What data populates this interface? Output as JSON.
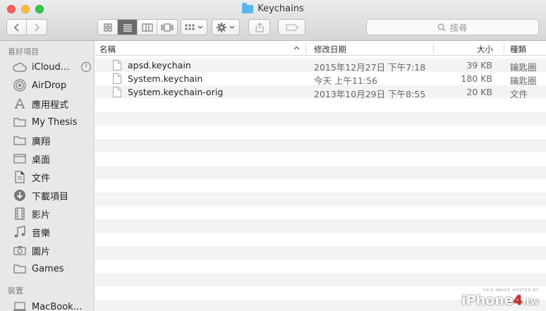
{
  "window": {
    "title": "Keychains"
  },
  "toolbar": {
    "search_placeholder": "搜尋"
  },
  "sidebar": {
    "favorites_heading": "喜好項目",
    "favorites": [
      {
        "label": "iCloud…",
        "icon": "cloud-icon"
      },
      {
        "label": "AirDrop",
        "icon": "airdrop-icon"
      },
      {
        "label": "應用程式",
        "icon": "applications-icon"
      },
      {
        "label": "My Thesis",
        "icon": "folder-icon"
      },
      {
        "label": "廣翔",
        "icon": "folder-icon"
      },
      {
        "label": "桌面",
        "icon": "desktop-icon"
      },
      {
        "label": "文件",
        "icon": "documents-icon"
      },
      {
        "label": "下載項目",
        "icon": "downloads-icon"
      },
      {
        "label": "影片",
        "icon": "movies-icon"
      },
      {
        "label": "音樂",
        "icon": "music-icon"
      },
      {
        "label": "圖片",
        "icon": "pictures-icon"
      },
      {
        "label": "Games",
        "icon": "folder-icon"
      }
    ],
    "devices_heading": "裝置",
    "devices": [
      {
        "label": "MacBook…",
        "icon": "laptop-icon"
      }
    ]
  },
  "columns": {
    "name": "名稱",
    "date": "修改日期",
    "size": "大小",
    "kind": "種類"
  },
  "files": [
    {
      "name": "apsd.keychain",
      "date": "2015年12月27日 下午7:18",
      "size": "39 KB",
      "kind": "鑰匙圈"
    },
    {
      "name": "System.keychain",
      "date": "今天 上午11:56",
      "size": "180 KB",
      "kind": "鑰匙圈"
    },
    {
      "name": "System.keychain-orig",
      "date": "2013年10月29日 下午8:55",
      "size": "20 KB",
      "kind": "文件"
    }
  ],
  "watermark": {
    "caption": "THIS IMAGE HOSTED BY",
    "brand_prefix": "iPhone",
    "brand_digit": "4",
    "brand_suffix": ".tw"
  },
  "colors": {
    "accent": "#5ab4ee",
    "sidebar_bg": "#e6e8ea",
    "active_view": "#6c6c6c"
  }
}
